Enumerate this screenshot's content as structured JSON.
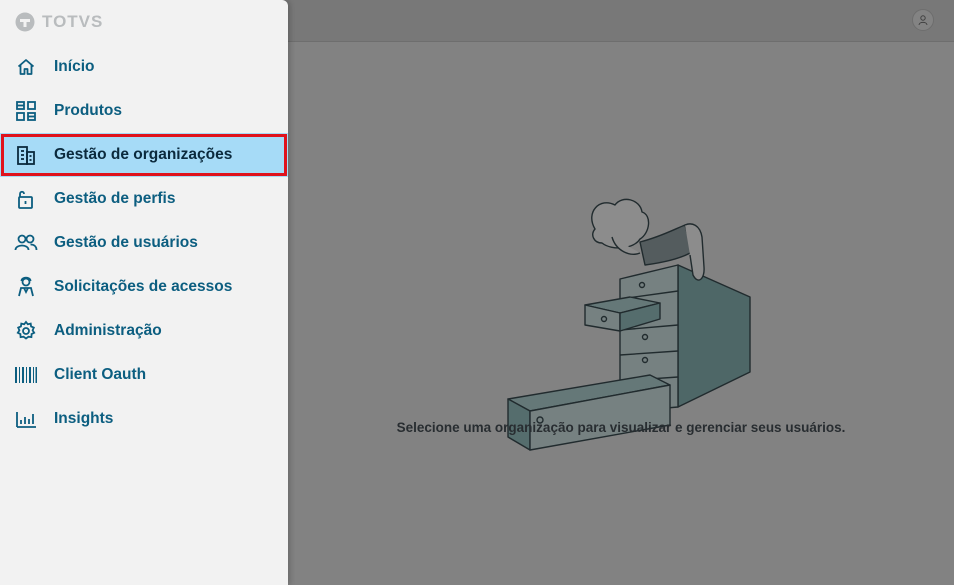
{
  "brand": {
    "logo_text": "TOTVS"
  },
  "main": {
    "empty_message": "Selecione uma organização para visualizar e gerenciar seus usuários."
  },
  "sidebar": {
    "items": [
      {
        "label": "Início",
        "icon": "home-icon"
      },
      {
        "label": "Produtos",
        "icon": "products-grid-icon"
      },
      {
        "label": "Gestão de organizações",
        "icon": "building-icon",
        "active": true
      },
      {
        "label": "Gestão de perfis",
        "icon": "unlock-icon"
      },
      {
        "label": "Gestão de usuários",
        "icon": "users-icon"
      },
      {
        "label": "Solicitações de acessos",
        "icon": "support-agent-icon"
      },
      {
        "label": "Administração",
        "icon": "gear-icon"
      },
      {
        "label": "Client Oauth",
        "icon": "barcode-icon"
      },
      {
        "label": "Insights",
        "icon": "bar-chart-icon"
      }
    ]
  },
  "colors": {
    "accent": "#0c5e80",
    "active_background": "#a6dbf7",
    "highlight_border": "#e0121c",
    "illustration": "#6fa7a7"
  }
}
